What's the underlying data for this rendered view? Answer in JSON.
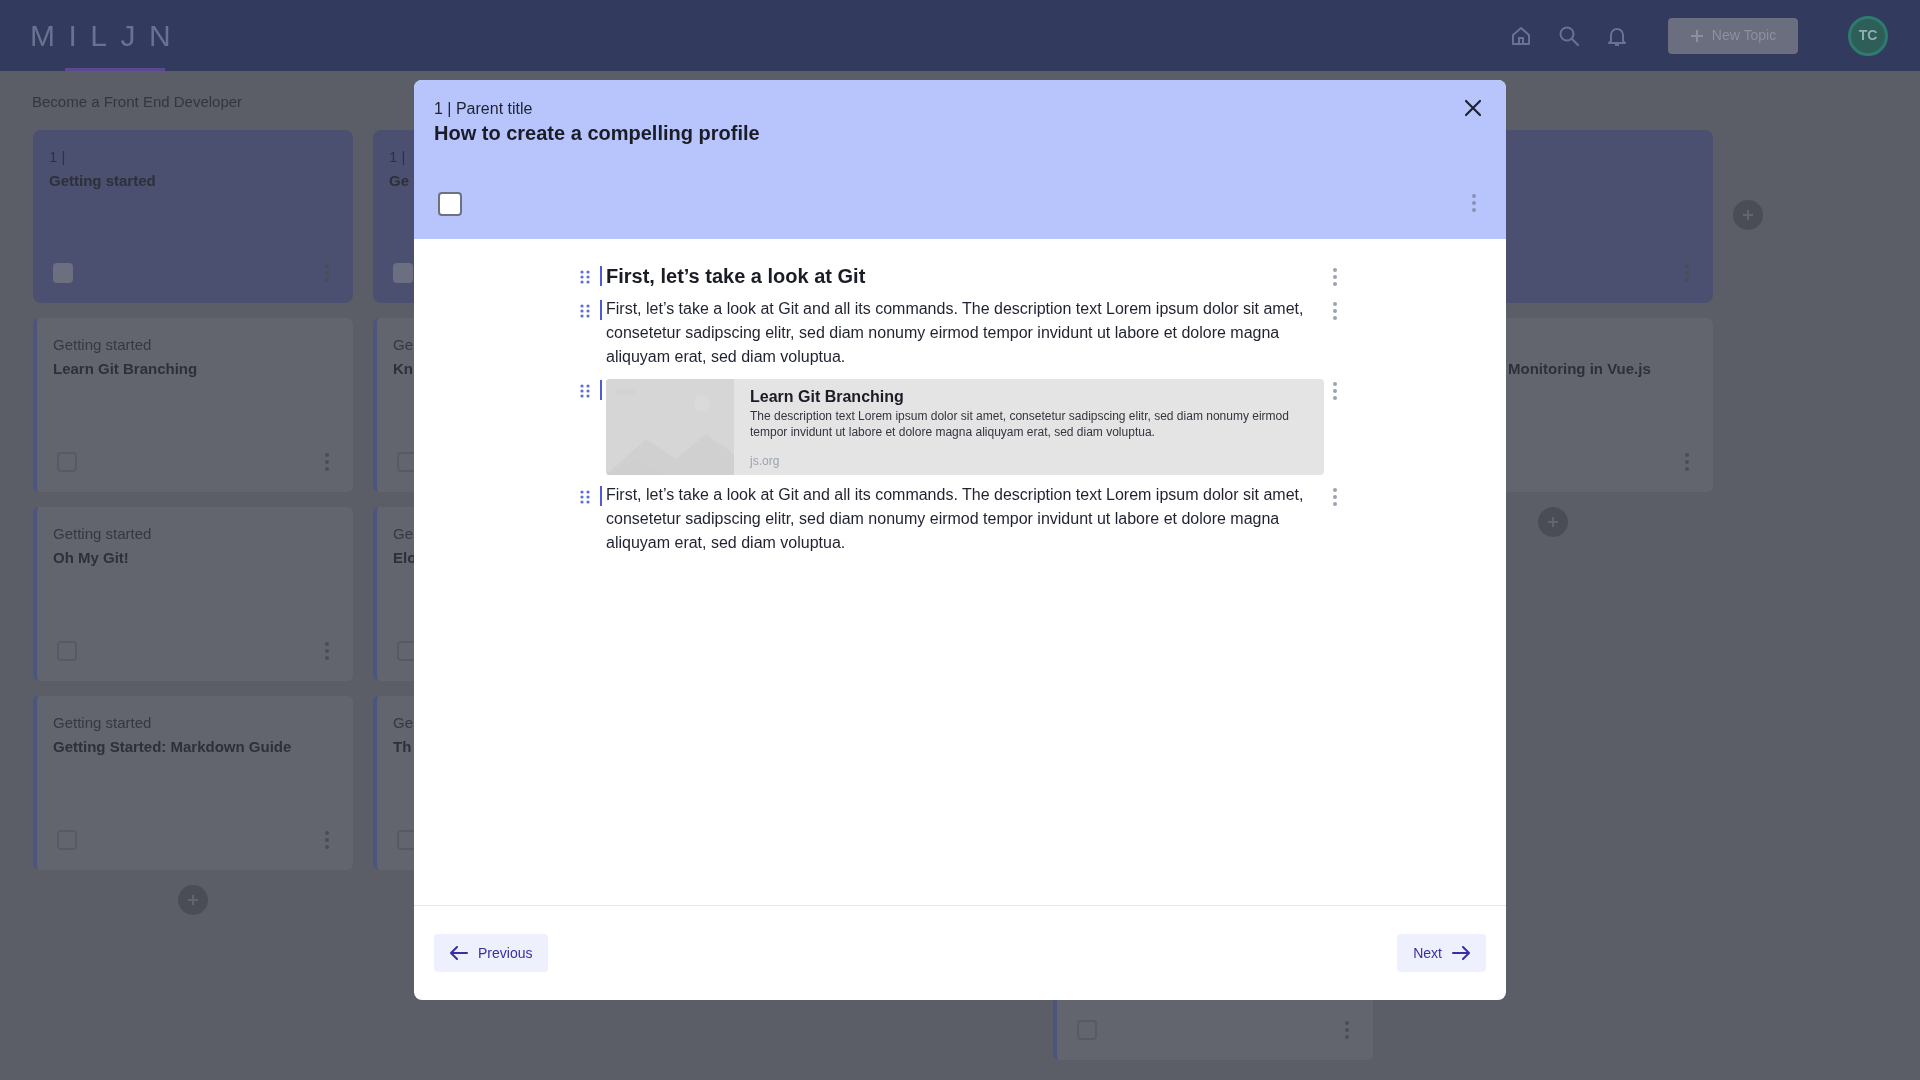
{
  "app_bar": {
    "logo": "MILJN",
    "new_topic_button": "New Topic",
    "avatar": "TC"
  },
  "breadcrumb": "Become a Front End Developer",
  "board": {
    "columns": [
      {
        "add_card": true,
        "cards": [
          {
            "kind": "parent",
            "label": "1 |",
            "title": "Getting started",
            "checked": false
          },
          {
            "kind": "topic",
            "label": "Getting started",
            "title": "Learn Git Branching",
            "checked": false
          },
          {
            "kind": "topic",
            "label": "Getting started",
            "title": "Oh My Git!",
            "checked": false
          },
          {
            "kind": "topic",
            "label": "Getting started",
            "title": "Getting Started: Markdown Guide",
            "checked": false
          }
        ]
      },
      {
        "add_card": false,
        "cards": [
          {
            "kind": "parent",
            "label": "1 |",
            "title": "Ge",
            "checked": false
          },
          {
            "kind": "topic",
            "label": "Ge",
            "title": "Kn",
            "checked": false
          },
          {
            "kind": "topic",
            "label": "Ge",
            "title": "Elo",
            "checked": false
          },
          {
            "kind": "topic",
            "label": "Ge",
            "title": "Th",
            "checked": false
          }
        ]
      },
      {
        "add_card": false,
        "cards": [
          {
            "kind": "topic",
            "checked": false
          }
        ]
      },
      {
        "add_card": true,
        "cards": [
          {
            "kind": "parent"
          },
          {
            "kind": "topic",
            "title": "Monitoring in Vue.js"
          }
        ]
      }
    ]
  },
  "modal": {
    "parent_label": "1 | Parent title",
    "title": "How to create a compelling profile",
    "checked": false,
    "blocks": [
      {
        "kind": "heading",
        "text": "First, let’s take a look at Git"
      },
      {
        "kind": "paragraph",
        "text": "First, let’s take a look at Git and all its commands. The description text Lorem ipsum dolor sit amet, consetetur sadipscing elitr, sed diam nonumy eirmod tempor invidunt ut labore et dolore magna aliquyam erat, sed diam voluptua."
      },
      {
        "kind": "link",
        "title": "Learn Git Branching",
        "description": "The description text Lorem ipsum dolor sit amet, consetetur sadipscing elitr, sed diam nonumy eirmod tempor invidunt ut labore et dolore magna aliquyam erat, sed diam voluptua.",
        "domain": "js.org"
      },
      {
        "kind": "paragraph",
        "text": "First, let’s take a look at Git and all its commands. The description text Lorem ipsum dolor sit amet, consetetur sadipscing elitr, sed diam nonumy eirmod tempor invidunt ut labore et dolore magna aliquyam erat, sed diam voluptua."
      }
    ],
    "previous_button": "Previous",
    "next_button": "Next"
  }
}
